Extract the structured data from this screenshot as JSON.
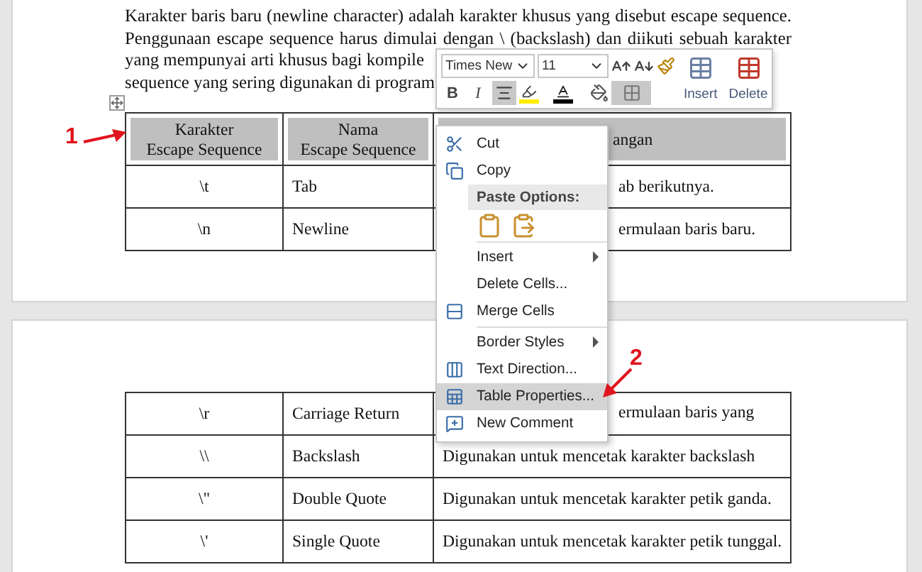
{
  "paragraph": {
    "lines": [
      {
        "text": "Karakter baris baru (newline character) adalah karakter khusus yang disebut escape sequence.",
        "justified": true
      },
      {
        "text": "Penggunaan escape sequence harus dimulai dengan \\ (backslash) dan diikuti sebuah karakter",
        "justified": true
      },
      {
        "text": "yang mempunyai arti khusus bagi kompile",
        "justified": false
      },
      {
        "text": "sequence yang sering digunakan di program",
        "justified": false
      }
    ]
  },
  "table_top": {
    "columns": [
      {
        "text": "Karakter\nEscape Sequence",
        "covered": false
      },
      {
        "text": "Nama\nEscape Sequence",
        "covered": false
      },
      {
        "text": "angan",
        "covered": true
      }
    ],
    "rows": [
      {
        "cells": [
          {
            "text": "\\t"
          },
          {
            "text": "Tab"
          },
          {
            "text": "ab berikutnya.",
            "covered": true
          }
        ]
      },
      {
        "cells": [
          {
            "text": "\\n"
          },
          {
            "text": "Newline"
          },
          {
            "text": "ermulaan baris baru.",
            "covered": true
          }
        ]
      }
    ]
  },
  "table_bottom": {
    "rows": [
      {
        "cells": [
          {
            "text": "\\r"
          },
          {
            "text": "Carriage Return"
          },
          {
            "text": "ermulaan baris yang",
            "covered": true
          }
        ]
      },
      {
        "cells": [
          {
            "text": "\\\\"
          },
          {
            "text": "Backslash"
          },
          {
            "text": "Digunakan untuk mencetak karakter backslash",
            "covered": false
          }
        ]
      },
      {
        "cells": [
          {
            "text": "\\\""
          },
          {
            "text": "Double Quote"
          },
          {
            "text": "Digunakan untuk mencetak karakter petik ganda.",
            "covered": false
          }
        ]
      },
      {
        "cells": [
          {
            "text": "\\'"
          },
          {
            "text": "Single Quote"
          },
          {
            "text": "Digunakan untuk mencetak karakter petik tunggal.",
            "covered": false
          }
        ]
      }
    ]
  },
  "mini_toolbar": {
    "font": "Times New",
    "size": "11",
    "bold": "B",
    "italic": "I",
    "align_center": {
      "selected": true
    },
    "borders": {
      "selected": true
    },
    "insert": "Insert",
    "delete": "Delete"
  },
  "context_menu": [
    {
      "kind": "item",
      "label": "Cut",
      "submenu": false,
      "selected": false
    },
    {
      "kind": "item",
      "label": "Copy",
      "submenu": false,
      "selected": false
    },
    {
      "kind": "header",
      "label": "Paste Options:"
    },
    {
      "kind": "paste_icons"
    },
    {
      "kind": "separator"
    },
    {
      "kind": "item",
      "label": "Insert",
      "submenu": true,
      "selected": false
    },
    {
      "kind": "item",
      "label": "Delete Cells...",
      "submenu": false,
      "selected": false
    },
    {
      "kind": "item",
      "label": "Merge Cells",
      "submenu": false,
      "selected": false
    },
    {
      "kind": "separator"
    },
    {
      "kind": "item",
      "label": "Border Styles",
      "submenu": true,
      "selected": false
    },
    {
      "kind": "item",
      "label": "Text Direction...",
      "submenu": false,
      "selected": false
    },
    {
      "kind": "item",
      "label": "Table Properties...",
      "submenu": false,
      "selected": true
    },
    {
      "kind": "item",
      "label": "New Comment",
      "submenu": false,
      "selected": false
    }
  ],
  "annotations": [
    {
      "label": "1"
    },
    {
      "label": "2"
    }
  ]
}
